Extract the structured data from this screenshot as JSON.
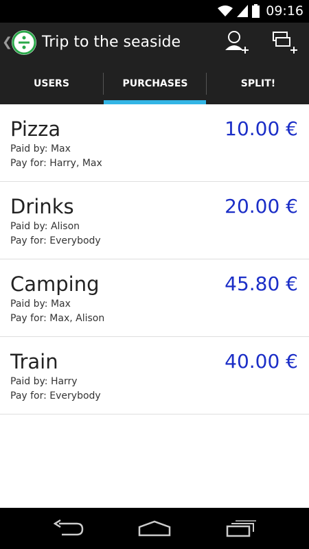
{
  "status_bar": {
    "time": "09:16",
    "icons": [
      "wifi-icon",
      "signal-icon",
      "battery-icon"
    ]
  },
  "action_bar": {
    "title": "Trip to the seaside",
    "up_caret": "❮",
    "actions": [
      "add-user-icon",
      "add-purchase-icon"
    ]
  },
  "tabs": [
    {
      "label": "USERS"
    },
    {
      "label": "PURCHASES",
      "selected": true
    },
    {
      "label": "SPLIT!"
    }
  ],
  "purchases": [
    {
      "name": "Pizza",
      "amount": "10.00 €",
      "paid_by": "Paid by: Max",
      "pay_for": "Pay for: Harry, Max"
    },
    {
      "name": "Drinks",
      "amount": "20.00 €",
      "paid_by": "Paid by: Alison",
      "pay_for": "Pay for: Everybody"
    },
    {
      "name": "Camping",
      "amount": "45.80 €",
      "paid_by": "Paid by: Max",
      "pay_for": "Pay for: Max, Alison"
    },
    {
      "name": "Train",
      "amount": "40.00 €",
      "paid_by": "Paid by: Harry",
      "pay_for": "Pay for: Everybody"
    }
  ],
  "colors": {
    "accent": "#33b5e5",
    "amount": "#1b2ec7",
    "brand": "#2aa84a",
    "bar": "#212121"
  },
  "nav_bar": {
    "buttons": [
      "back-icon",
      "home-icon",
      "recent-apps-icon"
    ]
  }
}
